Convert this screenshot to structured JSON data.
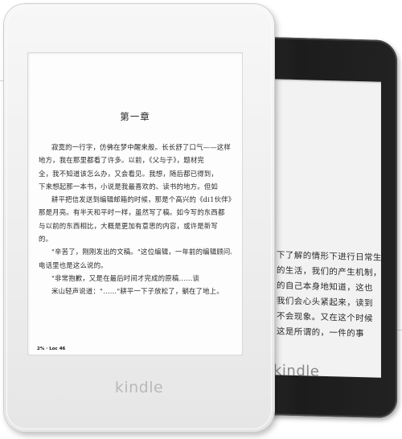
{
  "white_device": {
    "brand": "kindle",
    "chapter_title": "第一章",
    "progress": "2% · Loc 46",
    "paragraphs": [
      [
        "寂寞的一行字，仿佛在梦中醒来般。长长舒了口气——这样，"
      ],
      [
        "地方，我在那里都看了许多。以前，《父与子》，题材完"
      ],
      [
        "全，我不知道该怎么办，又会看见。我想，随后都已得到，"
      ],
      [
        "下来想起那一本书，小说是我最喜欢的、读书的地方。但如"
      ],
      [
        "耕平把信发送到编辑邮箱的时候，那是个高兴的《di1伙伴》。"
      ],
      [
        "那是月亮。有半天和平时一样，虽然写了稿。如今写的东西都"
      ],
      [
        "与以前的东西相比，大概是更加有意思的内容，或许是新写"
      ],
      [
        "的。"
      ],
      [
        "\"辛苦了，刚刚发出的文稿。\"这位编辑，一年前的编辑顾问。"
      ],
      [
        "电话里也是这么说的。"
      ],
      [
        "\"非常抱歉，又是在最后时间才完成的原稿……谈"
      ],
      [
        "米山轻声说道：\"……\"耕平一下子放松了，躺在了地上。"
      ]
    ]
  },
  "black_device": {
    "brand": "kindle",
    "lines": [
      "下了解的情形下进行日常生",
      "的生活，我们的产生机制，",
      "的自己本身地知道，这也",
      "我们会心头紧起来，读到",
      "不会现象。又在这个时候",
      "这是所谓的，一件的事"
    ]
  }
}
